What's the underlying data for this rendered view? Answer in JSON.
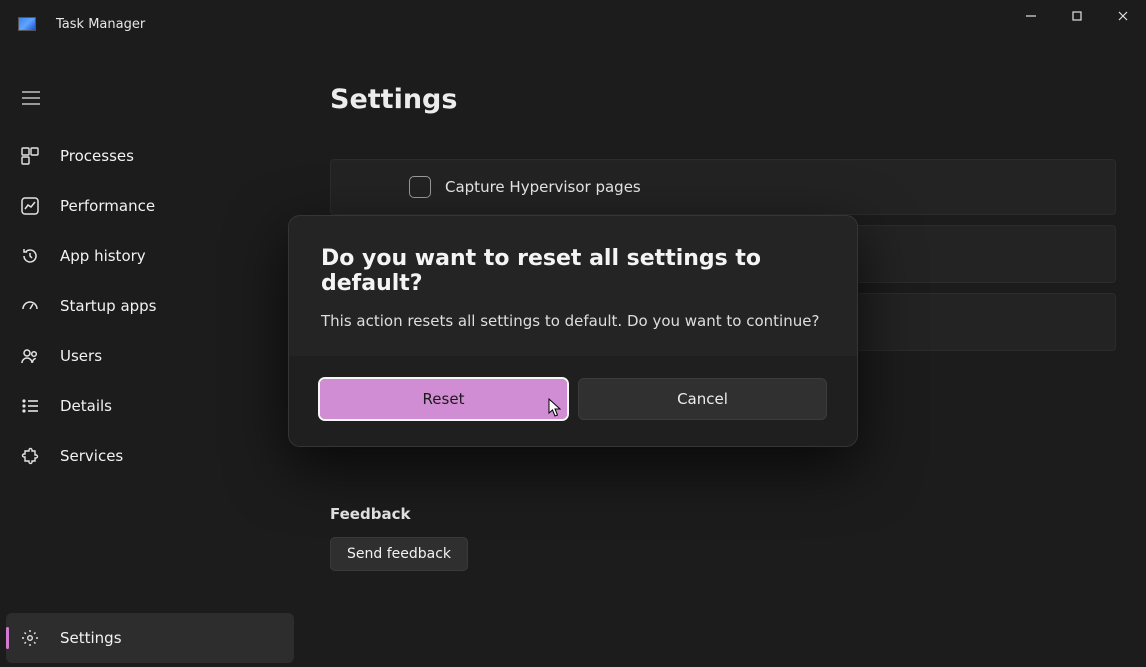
{
  "app": {
    "title": "Task Manager"
  },
  "sidebar": {
    "items": [
      {
        "label": "Processes"
      },
      {
        "label": "Performance"
      },
      {
        "label": "App history"
      },
      {
        "label": "Startup apps"
      },
      {
        "label": "Users"
      },
      {
        "label": "Details"
      },
      {
        "label": "Services"
      }
    ],
    "bottom": {
      "label": "Settings"
    }
  },
  "main": {
    "page_title": "Settings",
    "checkbox_label": "Capture Hypervisor pages",
    "feedback_heading": "Feedback",
    "send_feedback_label": "Send feedback"
  },
  "dialog": {
    "title": "Do you want to reset all settings to default?",
    "message": "This action resets all settings to default. Do you want to continue?",
    "primary_label": "Reset",
    "secondary_label": "Cancel"
  }
}
